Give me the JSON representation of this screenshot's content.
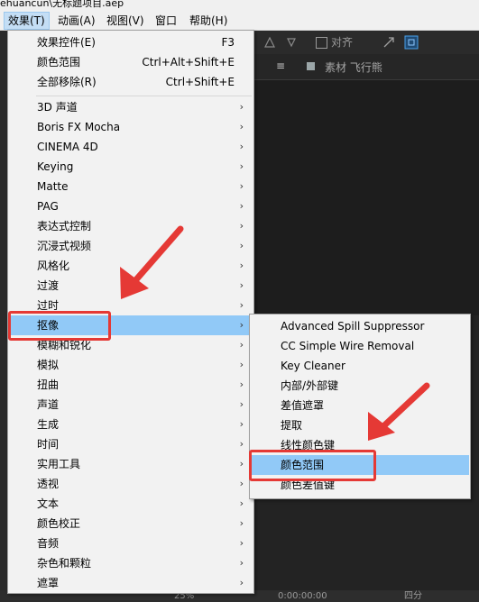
{
  "titlebar": {
    "text": "ehuancun\\无标题项目.aep"
  },
  "menubar": {
    "items": [
      "效果(T)",
      "动画(A)",
      "视图(V)",
      "窗口",
      "帮助(H)"
    ]
  },
  "toolbar": {
    "snap_label": "对齐"
  },
  "panel": {
    "tab_label": "素材 飞行熊"
  },
  "effects_menu": {
    "top_items": [
      {
        "label": "效果控件(E)",
        "shortcut": "F3"
      },
      {
        "label": "颜色范围",
        "shortcut": "Ctrl+Alt+Shift+E"
      },
      {
        "label": "全部移除(R)",
        "shortcut": "Ctrl+Shift+E"
      }
    ],
    "categories": [
      "3D 声道",
      "Boris FX Mocha",
      "CINEMA 4D",
      "Keying",
      "Matte",
      "PAG",
      "表达式控制",
      "沉浸式视频",
      "风格化",
      "过渡",
      "过时",
      "抠像",
      "模糊和锐化",
      "模拟",
      "扭曲",
      "声道",
      "生成",
      "时间",
      "实用工具",
      "透视",
      "文本",
      "颜色校正",
      "音频",
      "杂色和颗粒",
      "遮罩"
    ],
    "highlighted": "抠像"
  },
  "keying_submenu": {
    "items": [
      "Advanced Spill Suppressor",
      "CC Simple Wire Removal",
      "Key Cleaner",
      "内部/外部键",
      "差值遮罩",
      "提取",
      "线性颜色键",
      "颜色范围",
      "颜色差值键"
    ],
    "highlighted": "颜色范围"
  },
  "statusbar": {
    "zoom": "25%",
    "timecode": "0:00:00:00",
    "view": "四分"
  },
  "colors": {
    "highlight": "#91c9f7",
    "annotation": "#e53935",
    "menu_bg": "#f2f2f2"
  }
}
